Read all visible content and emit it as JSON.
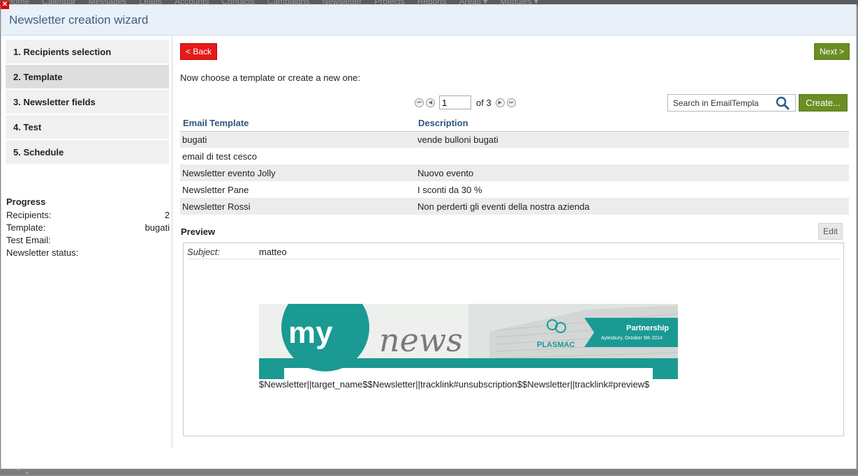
{
  "background": {
    "nav_items": [
      "Home",
      "Calendar",
      "Messages",
      "Leads",
      "Accounts",
      "Contacts",
      "Campaigns",
      "Newsletter",
      "Projects",
      "Reports",
      "Areas ▾",
      "Modules ▾"
    ]
  },
  "dialog": {
    "title": "Newsletter creation wizard",
    "close_glyph": "✕"
  },
  "steps": [
    {
      "label": "1. Recipients selection",
      "active": false
    },
    {
      "label": "2. Template",
      "active": true
    },
    {
      "label": "3. Newsletter fields",
      "active": false
    },
    {
      "label": "4. Test",
      "active": false
    },
    {
      "label": "5. Schedule",
      "active": false
    }
  ],
  "progress": {
    "title": "Progress",
    "rows": [
      {
        "label": "Recipients:",
        "value": "2"
      },
      {
        "label": "Template:",
        "value": "bugati"
      },
      {
        "label": "Test Email:",
        "value": ""
      },
      {
        "label": "Newsletter status:",
        "value": ""
      }
    ]
  },
  "toolbar": {
    "back_label": "< Back",
    "next_label": "Next >",
    "create_label": "Create...",
    "instruction": "Now choose a template or create a new one:"
  },
  "pager": {
    "current_page": "1",
    "of_text": "of 3",
    "first_glyph": "⏮",
    "prev_glyph": "◀",
    "next_glyph": "▶",
    "last_glyph": "⏭"
  },
  "search": {
    "placeholder": "Search in EmailTempla"
  },
  "table": {
    "columns": [
      "Email Template",
      "Description"
    ],
    "rows": [
      [
        "bugati",
        "vende bulloni bugati"
      ],
      [
        "email di test cesco",
        ""
      ],
      [
        "Newsletter evento Jolly",
        "Nuovo evento"
      ],
      [
        "Newsletter Pane",
        "I sconti da 30 %"
      ],
      [
        "Newsletter Rossi",
        "Non perderti gli eventi della nostra azienda"
      ]
    ]
  },
  "preview": {
    "label": "Preview",
    "edit_label": "Edit",
    "subject_label": "Subject:",
    "subject_value": "matteo",
    "banner": {
      "brand_my": "my",
      "brand_news": "news",
      "company": "PLASMAC",
      "ribbon_title": "Partnership",
      "ribbon_subtitle": "Aylesbury, October 9th 2014",
      "teal": "#1a9a93"
    },
    "template_text": "$Newsletter||target_name$$Newsletter||tracklink#unsubscription$$Newsletter||tracklink#preview$"
  },
  "colors": {
    "back_button": "#e51b1b",
    "next_button": "#6a8e23",
    "header_bg": "#e9f0f7",
    "title_color": "#3e5f83",
    "column_header": "#2f567f"
  }
}
